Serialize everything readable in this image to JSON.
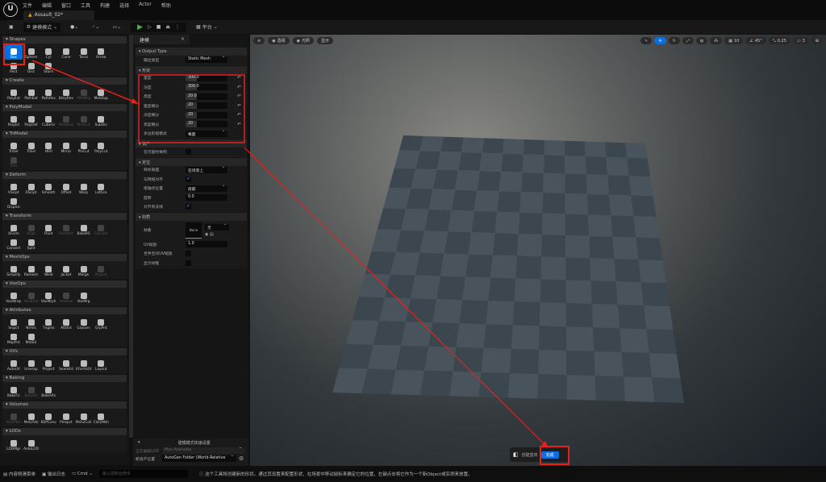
{
  "app": {
    "menus": [
      "文件",
      "编辑",
      "窗口",
      "工具",
      "构建",
      "选择",
      "Actor",
      "帮助"
    ],
    "document_tab": "Assault_02*"
  },
  "toolbar": {
    "mode": "建模模式",
    "platform": "平台"
  },
  "tool_palette": {
    "sections": [
      {
        "title": "Shapes",
        "tools": [
          {
            "label": "Box",
            "selected": true
          },
          {
            "label": "Sphere"
          },
          {
            "label": "Cyl"
          },
          {
            "label": "Cone"
          },
          {
            "label": "Torus"
          },
          {
            "label": "Arrow"
          },
          {
            "label": "Rect"
          },
          {
            "label": "Disc"
          },
          {
            "label": "Stairs"
          }
        ]
      },
      {
        "title": "Create",
        "tools": [
          {
            "label": "PolyExt"
          },
          {
            "label": "PathExt"
          },
          {
            "label": "PathRev"
          },
          {
            "label": "BdryRev"
          },
          {
            "label": "MshMrg",
            "disabled": true
          },
          {
            "label": "MshDup"
          }
        ]
      },
      {
        "title": "PolyModel",
        "tools": [
          {
            "label": "PolyEd"
          },
          {
            "label": "PolyDef"
          },
          {
            "label": "CubeGr"
          },
          {
            "label": "MshBool",
            "disabled": true
          },
          {
            "label": "MshCut",
            "disabled": true
          },
          {
            "label": "SubDiv"
          }
        ]
      },
      {
        "title": "TriModel",
        "tools": [
          {
            "label": "TriSel"
          },
          {
            "label": "TriEd"
          },
          {
            "label": "HFill"
          },
          {
            "label": "Mirror"
          },
          {
            "label": "PlnCut"
          },
          {
            "label": "PolyCut"
          },
          {
            "label": "Trim",
            "disabled": true
          }
        ]
      },
      {
        "title": "Deform",
        "tools": [
          {
            "label": "VScipt"
          },
          {
            "label": "DScipt"
          },
          {
            "label": "Smooth"
          },
          {
            "label": "Offset"
          },
          {
            "label": "Warp"
          },
          {
            "label": "Lattice"
          },
          {
            "label": "Displce"
          }
        ]
      },
      {
        "title": "Transform",
        "tools": [
          {
            "label": "XForm"
          },
          {
            "label": "Align",
            "disabled": true
          },
          {
            "label": "Pivot"
          },
          {
            "label": "PivotAct",
            "disabled": true
          },
          {
            "label": "BakeRS"
          },
          {
            "label": "Transfer",
            "disabled": true
          },
          {
            "label": "Convert"
          },
          {
            "label": "Split"
          }
        ]
      },
      {
        "title": "MeshOps",
        "tools": [
          {
            "label": "Simplify"
          },
          {
            "label": "Remesh"
          },
          {
            "label": "Weld"
          },
          {
            "label": "Jacket"
          },
          {
            "label": "Merge"
          },
          {
            "label": "Project",
            "disabled": true
          }
        ]
      },
      {
        "title": "VoxOps",
        "tools": [
          {
            "label": "VoxWrap"
          },
          {
            "label": "VoxBlnd",
            "disabled": true
          },
          {
            "label": "VoxMrph"
          },
          {
            "label": "VoxBool",
            "disabled": true
          },
          {
            "label": "VoxMrg"
          }
        ]
      },
      {
        "title": "Attributes",
        "tools": [
          {
            "label": "Inspct"
          },
          {
            "label": "Nrmls"
          },
          {
            "label": "Tngnts"
          },
          {
            "label": "AttrEd"
          },
          {
            "label": "GrpGen"
          },
          {
            "label": "GrpPnt"
          },
          {
            "label": "MapPnt"
          },
          {
            "label": "MatEd"
          }
        ]
      },
      {
        "title": "UVs",
        "tools": [
          {
            "label": "AutoUV"
          },
          {
            "label": "Unwrap"
          },
          {
            "label": "Project"
          },
          {
            "label": "SeamEd"
          },
          {
            "label": "XFormUV"
          },
          {
            "label": "Layout"
          }
        ]
      },
      {
        "title": "Baking",
        "tools": [
          {
            "label": "BakeTx"
          },
          {
            "label": "BakeAll",
            "disabled": true
          },
          {
            "label": "BakeVtx"
          }
        ]
      },
      {
        "title": "Volumes",
        "tools": [
          {
            "label": "Vol2Msh",
            "disabled": true
          },
          {
            "label": "Msh2Vol"
          },
          {
            "label": "BSPConv"
          },
          {
            "label": "PInspct"
          },
          {
            "label": "Msh2Coll"
          },
          {
            "label": "Coll2Msh"
          }
        ]
      },
      {
        "title": "LODs",
        "tools": [
          {
            "label": "LODMgr"
          },
          {
            "label": "AutoLOD"
          }
        ]
      }
    ]
  },
  "details": {
    "tab": "建模",
    "output_type": {
      "header": "Output Type",
      "label": "输出类型",
      "value": "Static Mesh"
    },
    "shape": {
      "header": "形状",
      "rows": [
        {
          "label": "宽度",
          "value": "300.0"
        },
        {
          "label": "深度",
          "value": "300.0"
        },
        {
          "label": "高度",
          "value": "20.0"
        },
        {
          "label": "宽度细分",
          "value": "20"
        },
        {
          "label": "深度细分",
          "value": "20"
        },
        {
          "label": "高度细分",
          "value": "20"
        }
      ],
      "polygroup_label": "多边形组模式",
      "polygroup_value": "每面"
    },
    "asset": {
      "header": "资产",
      "instance_label": "在可能时举例",
      "instance_checked": false
    },
    "positioning": {
      "header": "定位",
      "target_label": "目标表面",
      "target_value": "在场景上",
      "align_label": "与网格对齐",
      "align_checked": true,
      "pivot_label": "枢轴点位置",
      "pivot_value": "底部",
      "rotation_label": "旋转",
      "rotation_value": "0.0",
      "normal_label": "对齐到法线",
      "normal_checked": true
    },
    "material": {
      "header": "材质",
      "label": "材质",
      "thumb": "None",
      "select_value": "无",
      "uv_scale_label": "UV缩放",
      "uv_scale_value": "1.0",
      "world_uv_label": "世界空间UV缩放",
      "wireframe_label": "显示线框"
    },
    "footer": {
      "title": "建模模式快速设置",
      "lod_label": "正在编辑LOD",
      "lod_value": "Max Available",
      "asset_loc_label": "新资产位置",
      "asset_loc_value": "AutoGen Folder (World-Relative"
    }
  },
  "viewport": {
    "perspective": "透视",
    "lit": "光照",
    "show": "显示",
    "grid_snap": "10",
    "rot_snap": "45°",
    "scale_snap": "0.25",
    "camera_speed": "3",
    "create_label": "创建盒体",
    "finish_label": "完成",
    "checker_colors": [
      "#3c464e",
      "#48535b"
    ]
  },
  "statusbar": {
    "content_drawer": "内容侧滑菜单",
    "output_log": "输出日志",
    "cmd": "Cmd",
    "cmd_placeholder": "输入控制台命令",
    "message": "这个工具将创建新的形状。通过其设置来配置形状，在场景中移动鼠标来确定它的位置，左键点击将它作为一个新Object或实例来放置。"
  },
  "annotation_color": "#e8201c"
}
